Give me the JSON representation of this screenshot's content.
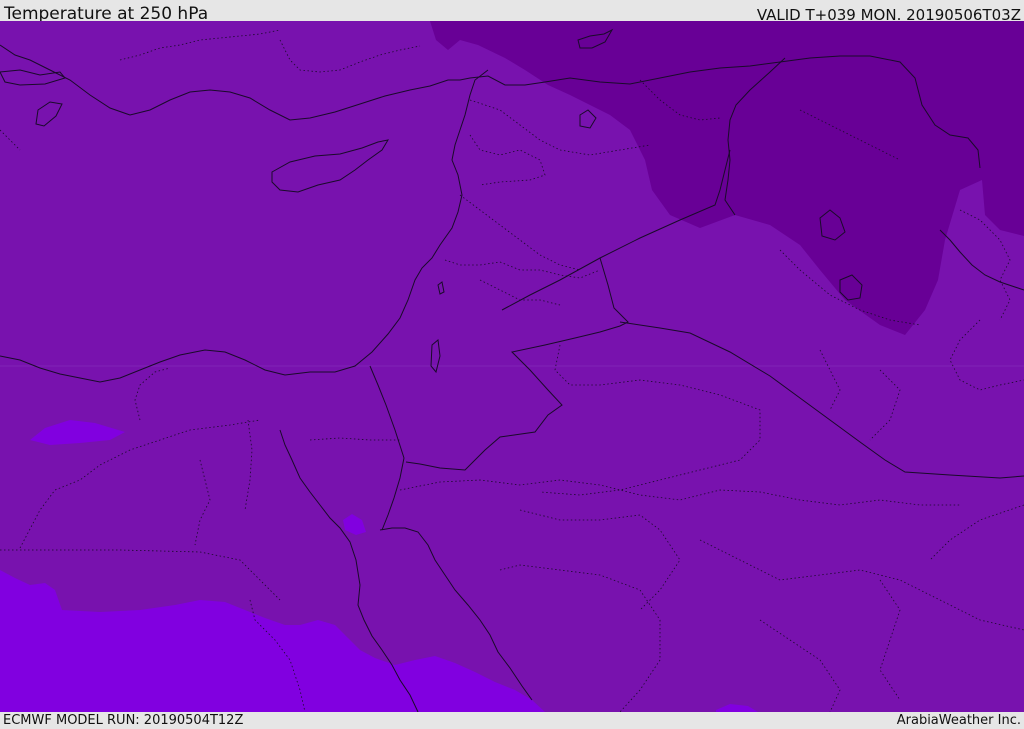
{
  "header": {
    "title": "Temperature at 250 hPa",
    "valid_time": "VALID T+039 MON. 20190506T03Z"
  },
  "footer": {
    "model_run": "ECMWF MODEL RUN: 20190504T12Z",
    "credit": "ArabiaWeather Inc."
  },
  "map": {
    "colors": {
      "base_field": "#7812ae",
      "cold_field": "#680096",
      "warm_field": "#8100e0",
      "coast": "#1a0a2a",
      "border": "#1a0a2a"
    }
  }
}
